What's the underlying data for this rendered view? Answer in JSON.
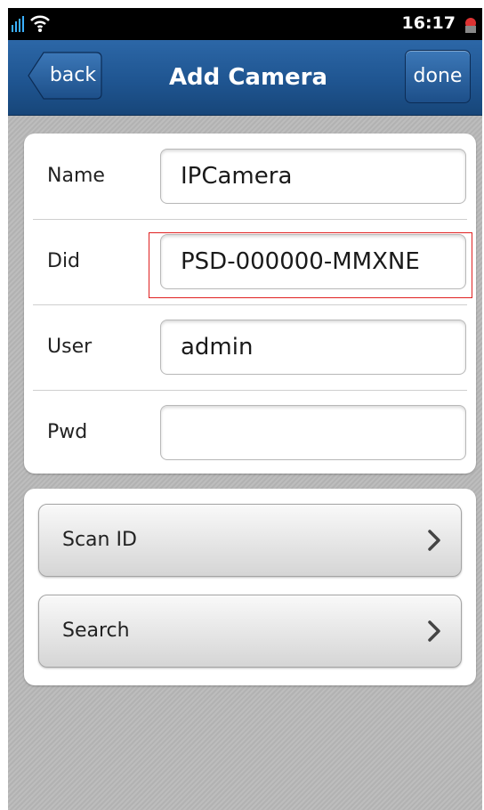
{
  "status_bar": {
    "time": "16:17"
  },
  "nav": {
    "back_label": "back",
    "title": "Add Camera",
    "done_label": "done"
  },
  "form": {
    "name": {
      "label": "Name",
      "value": "IPCamera"
    },
    "did": {
      "label": "Did",
      "value": "PSD-000000-MMXNE"
    },
    "user": {
      "label": "User",
      "value": "admin"
    },
    "pwd": {
      "label": "Pwd",
      "value": ""
    }
  },
  "actions": {
    "scan_label": "Scan ID",
    "search_label": "Search"
  },
  "colors": {
    "nav_bar": "#1f5591",
    "highlight": "#e02020",
    "background": "#b9b9b9"
  },
  "icons": [
    "signal-icon",
    "wifi-icon",
    "battery-icon",
    "chevron-right-icon"
  ]
}
